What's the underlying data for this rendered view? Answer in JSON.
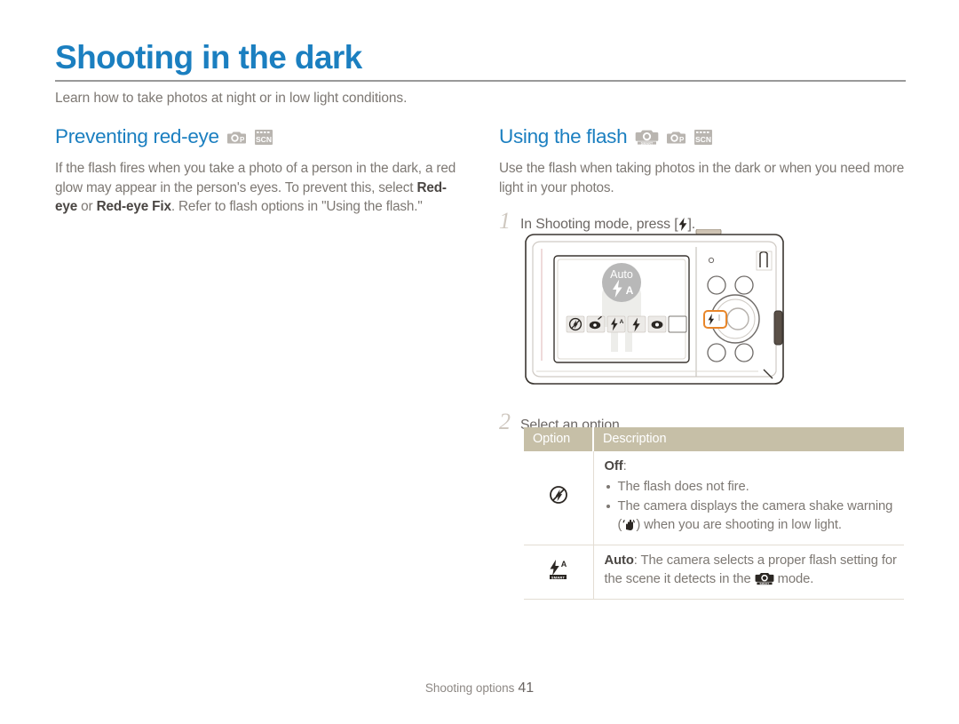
{
  "document": {
    "title": "Shooting in the dark",
    "subtitle": "Learn how to take photos at night or in low light conditions.",
    "accent_color": "#1b7fc0",
    "rule_color": "#9a9a9a",
    "table_header_color": "#c6bfa7",
    "highlight_color": "#e8862a"
  },
  "sections": {
    "left": {
      "heading": "Preventing red-eye",
      "mode_icons": [
        "program-mode-icon",
        "scene-mode-icon"
      ],
      "paragraph_parts": [
        {
          "text": "If the flash fires when you take a photo of a person in the dark, a red glow may appear in the person's eyes. To prevent this, select ",
          "bold": false
        },
        {
          "text": "Red-eye",
          "bold": true
        },
        {
          "text": " or ",
          "bold": false
        },
        {
          "text": "Red-eye Fix",
          "bold": true
        },
        {
          "text": ". Refer to flash options in \"Using the flash.\"",
          "bold": false
        }
      ]
    },
    "right": {
      "heading": "Using the flash",
      "mode_icons": [
        "smart-auto-mode-icon",
        "program-mode-icon",
        "scene-mode-icon"
      ],
      "paragraph": "Use the flash when taking photos in the dark or when you need more light in your photos.",
      "steps": [
        {
          "number": "1",
          "text_before": "In Shooting mode, press [",
          "icon": "flash-icon",
          "text_after": "]."
        },
        {
          "number": "2",
          "text_before": "Select an option.",
          "icon": "",
          "text_after": ""
        }
      ]
    }
  },
  "camera_illustration": {
    "screen_overlay_label": "Auto",
    "screen_overlay_icon": "flash-auto-icon",
    "flash_option_icons": [
      "flash-off-icon",
      "red-eye-icon",
      "flash-auto-icon",
      "fill-in-flash-icon",
      "red-eye-fix-icon",
      "blank-option-icon"
    ],
    "highlighted_button": "flash-button",
    "speaker_label": "speaker-holes"
  },
  "option_table": {
    "columns": [
      "Option",
      "Description"
    ],
    "rows": [
      {
        "icon": "flash-off-icon",
        "label": "Off",
        "label_suffix": ":",
        "bullets": [
          {
            "text_before": "The flash does not fire.",
            "icon": "",
            "text_after": ""
          },
          {
            "text_before": "The camera displays the camera shake warning (",
            "icon": "camera-shake-icon",
            "text_after": ") when you are shooting in low light."
          }
        ]
      },
      {
        "icon": "flash-auto-icon",
        "label": "Auto",
        "label_suffix": ":",
        "description_before": " The camera selects a proper flash setting for the scene it detects in the ",
        "inline_icon": "smart-auto-mode-icon",
        "description_after": " mode."
      }
    ]
  },
  "footer": {
    "label": "Shooting options",
    "page_number": "41"
  }
}
